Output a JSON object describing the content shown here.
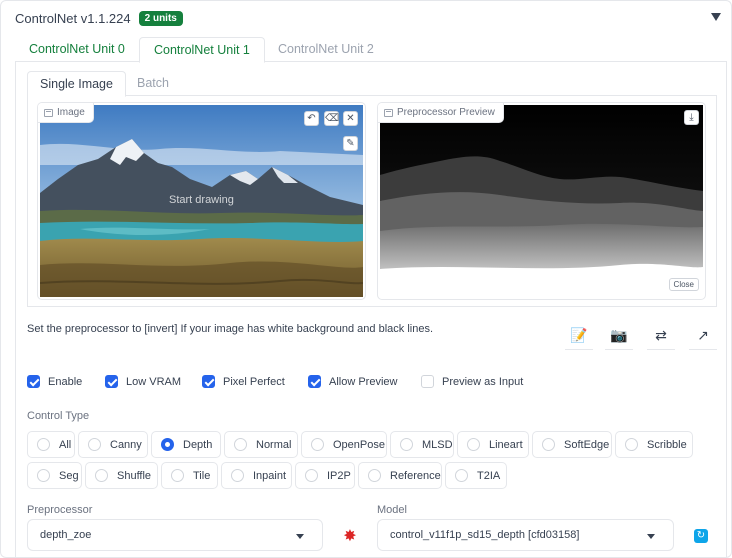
{
  "header": {
    "title": "ControlNet v1.1.224",
    "badge": "2 units"
  },
  "unit_tabs": [
    {
      "label": "ControlNet Unit 0"
    },
    {
      "label": "ControlNet Unit 1"
    },
    {
      "label": "ControlNet Unit 2"
    }
  ],
  "sub_tabs": [
    {
      "label": "Single Image"
    },
    {
      "label": "Batch"
    }
  ],
  "image_panel": {
    "label": "Image",
    "placeholder": "Start drawing"
  },
  "preview_panel": {
    "label": "Preprocessor Preview",
    "close_label": "Close"
  },
  "hint": "Set the preprocessor to [invert] If your image has white background and black lines.",
  "checkboxes": [
    {
      "label": "Enable",
      "checked": true
    },
    {
      "label": "Low VRAM",
      "checked": true
    },
    {
      "label": "Pixel Perfect",
      "checked": true
    },
    {
      "label": "Allow Preview",
      "checked": true
    },
    {
      "label": "Preview as Input",
      "checked": false
    }
  ],
  "control_type": {
    "label": "Control Type",
    "selected": "Depth",
    "options_row1": [
      "All",
      "Canny",
      "Depth",
      "Normal",
      "OpenPose",
      "MLSD",
      "Lineart",
      "SoftEdge",
      "Scribble"
    ],
    "options_row2": [
      "Seg",
      "Shuffle",
      "Tile",
      "Inpaint",
      "IP2P",
      "Reference",
      "T2IA"
    ]
  },
  "preprocessor": {
    "label": "Preprocessor",
    "value": "depth_zoe"
  },
  "model": {
    "label": "Model",
    "value": "control_v11f1p_sd15_depth [cfd03158]"
  },
  "icons": {
    "edit": "edit-icon",
    "camera": "camera-icon",
    "swap": "swap-icon",
    "send": "send-dimensions-icon",
    "run": "explosion-icon",
    "refresh": "refresh-icon"
  },
  "colors": {
    "accent": "#2563eb",
    "badge": "#15803d",
    "unit_tab": "#15803d",
    "run": "#dc2626",
    "refresh": "#0ea5e9"
  }
}
